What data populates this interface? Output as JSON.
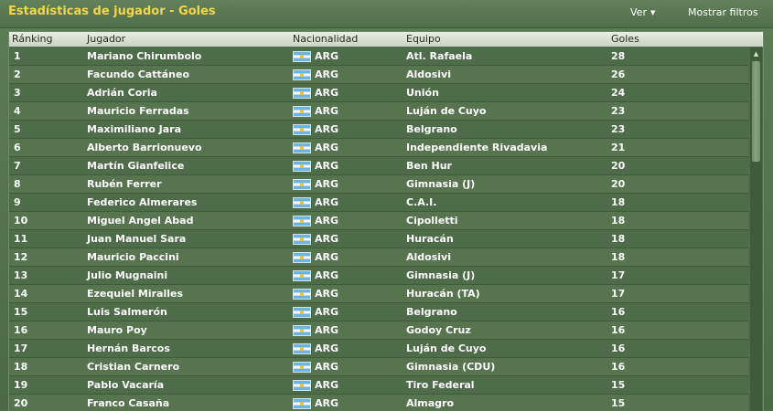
{
  "window": {
    "title": "Estadísticas de jugador - Goles",
    "ver_label": "Ver",
    "filters_label": "Mostrar filtros"
  },
  "table": {
    "columns": [
      "Ránking",
      "Jugador",
      "Nacionalidad",
      "Equipo",
      "Goles"
    ],
    "rows": [
      {
        "rank": "1",
        "player": "Mariano Chirumbolo",
        "nat": "ARG",
        "team": "Atl. Rafaela",
        "goals": "28"
      },
      {
        "rank": "2",
        "player": "Facundo Cattáneo",
        "nat": "ARG",
        "team": "Aldosivi",
        "goals": "26"
      },
      {
        "rank": "3",
        "player": "Adrián Coria",
        "nat": "ARG",
        "team": "Unión",
        "goals": "24"
      },
      {
        "rank": "4",
        "player": "Mauricio Ferradas",
        "nat": "ARG",
        "team": "Luján de Cuyo",
        "goals": "23"
      },
      {
        "rank": "5",
        "player": "Maximiliano Jara",
        "nat": "ARG",
        "team": "Belgrano",
        "goals": "23"
      },
      {
        "rank": "6",
        "player": "Alberto Barrionuevo",
        "nat": "ARG",
        "team": "Independiente Rivadavia",
        "goals": "21"
      },
      {
        "rank": "7",
        "player": "Martín Gianfelice",
        "nat": "ARG",
        "team": "Ben Hur",
        "goals": "20"
      },
      {
        "rank": "8",
        "player": "Rubén Ferrer",
        "nat": "ARG",
        "team": "Gimnasia (J)",
        "goals": "20"
      },
      {
        "rank": "9",
        "player": "Federico Almerares",
        "nat": "ARG",
        "team": "C.A.I.",
        "goals": "18"
      },
      {
        "rank": "10",
        "player": "Miguel Angel Abad",
        "nat": "ARG",
        "team": "Cipolletti",
        "goals": "18"
      },
      {
        "rank": "11",
        "player": "Juan Manuel Sara",
        "nat": "ARG",
        "team": "Huracán",
        "goals": "18"
      },
      {
        "rank": "12",
        "player": "Mauricio Paccini",
        "nat": "ARG",
        "team": "Aldosivi",
        "goals": "18"
      },
      {
        "rank": "13",
        "player": "Julio Mugnaini",
        "nat": "ARG",
        "team": "Gimnasia (J)",
        "goals": "17"
      },
      {
        "rank": "14",
        "player": "Ezequiel Miralles",
        "nat": "ARG",
        "team": "Huracán (TA)",
        "goals": "17"
      },
      {
        "rank": "15",
        "player": "Luis Salmerón",
        "nat": "ARG",
        "team": "Belgrano",
        "goals": "16"
      },
      {
        "rank": "16",
        "player": "Mauro Poy",
        "nat": "ARG",
        "team": "Godoy Cruz",
        "goals": "16"
      },
      {
        "rank": "17",
        "player": "Hernán Barcos",
        "nat": "ARG",
        "team": "Luján de Cuyo",
        "goals": "16"
      },
      {
        "rank": "18",
        "player": "Cristian Carnero",
        "nat": "ARG",
        "team": "Gimnasia (CDU)",
        "goals": "16"
      },
      {
        "rank": "19",
        "player": "Pablo Vacaría",
        "nat": "ARG",
        "team": "Tiro Federal",
        "goals": "15"
      },
      {
        "rank": "20",
        "player": "Franco Casaña",
        "nat": "ARG",
        "team": "Almagro",
        "goals": "15"
      }
    ]
  },
  "icons": {
    "flag": "argentina-flag-icon",
    "dropdown": "caret-down-icon",
    "scroll_up": "arrow-up-icon"
  },
  "colors": {
    "title": "#f4d44b",
    "background": "#4d6c48",
    "row_alt": "#56754f",
    "header": "#dfe6da"
  }
}
